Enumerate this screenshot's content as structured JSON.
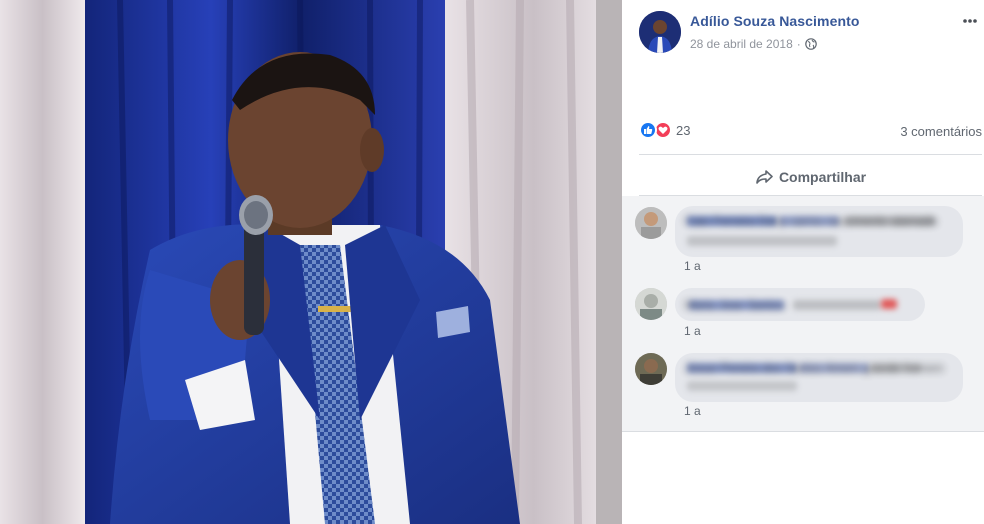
{
  "post": {
    "author": "Adílio Souza Nascimento",
    "date": "28 de abril de 2018",
    "separator": "·",
    "privacy_icon": "globe-icon",
    "more_icon": "more-dots-icon"
  },
  "reactions": {
    "count": "23",
    "types": [
      "like",
      "love"
    ]
  },
  "comments_summary": "3 comentários",
  "actions": {
    "share_label": "Compartilhar"
  },
  "comments": [
    {
      "text": "Caio Ferreira Dany carmo nascimento aiamado",
      "time": "1 a"
    },
    {
      "text": "Maria Jose Santos",
      "time": "1 a"
    },
    {
      "text": "Josue Pereira dos Santos Amem grande homem",
      "time": "1 a"
    }
  ],
  "colors": {
    "author_link": "#385898",
    "like": "#1877f2",
    "love": "#f33e58",
    "comment_bg": "#f2f3f5",
    "bubble": "#e4e6eb"
  }
}
